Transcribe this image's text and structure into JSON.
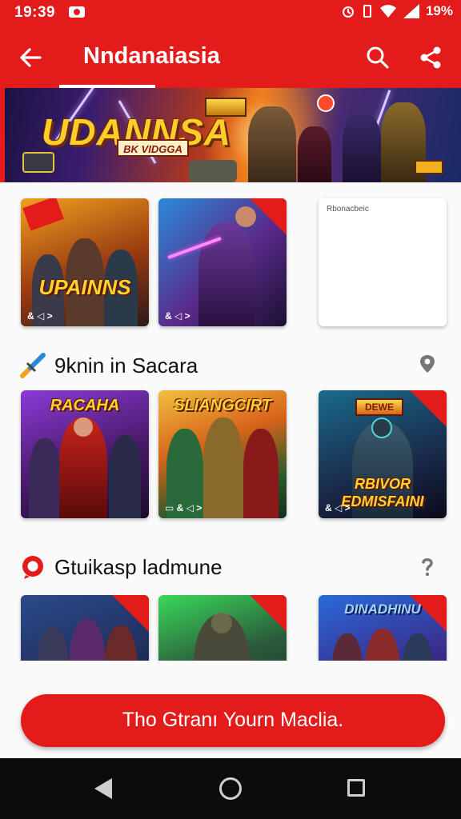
{
  "status_bar": {
    "time": "19:39",
    "battery": "19%"
  },
  "app_bar": {
    "title": "Nndanaiasia"
  },
  "banner": {
    "title": "UDANNSA",
    "subtitle": "BK VIDGGA"
  },
  "row1": {
    "tiles": [
      {
        "label": "UPAINNS",
        "foot": "& ◁ >"
      },
      {
        "label": "",
        "foot": "& ◁ >"
      },
      {
        "label": "Rbonacbeic"
      }
    ]
  },
  "section1": {
    "title": "9knin in Sacara"
  },
  "row2": {
    "tiles": [
      {
        "label": "RACAHA",
        "foot": ""
      },
      {
        "label": "SLIANGCIRT",
        "foot": "▭ & ◁ >"
      },
      {
        "label": "RBIVOR EDMISFAINI",
        "label_top": "DEWE",
        "foot": "& ◁ >"
      }
    ]
  },
  "section2": {
    "title": "Gtuikasp ladmune"
  },
  "row3": {
    "tiles": [
      {
        "label": ""
      },
      {
        "label": ""
      },
      {
        "label": "DINADHINU"
      }
    ]
  },
  "cta": {
    "label": "Tho Gtranı Yourn Maclia."
  },
  "colors": {
    "accent": "#e31b1b",
    "gold": "#ffd230"
  },
  "icons": [
    "back-arrow-icon",
    "search-icon",
    "share-icon",
    "sword-icon",
    "location-pin-icon",
    "chat-bubble-icon",
    "help-icon"
  ]
}
